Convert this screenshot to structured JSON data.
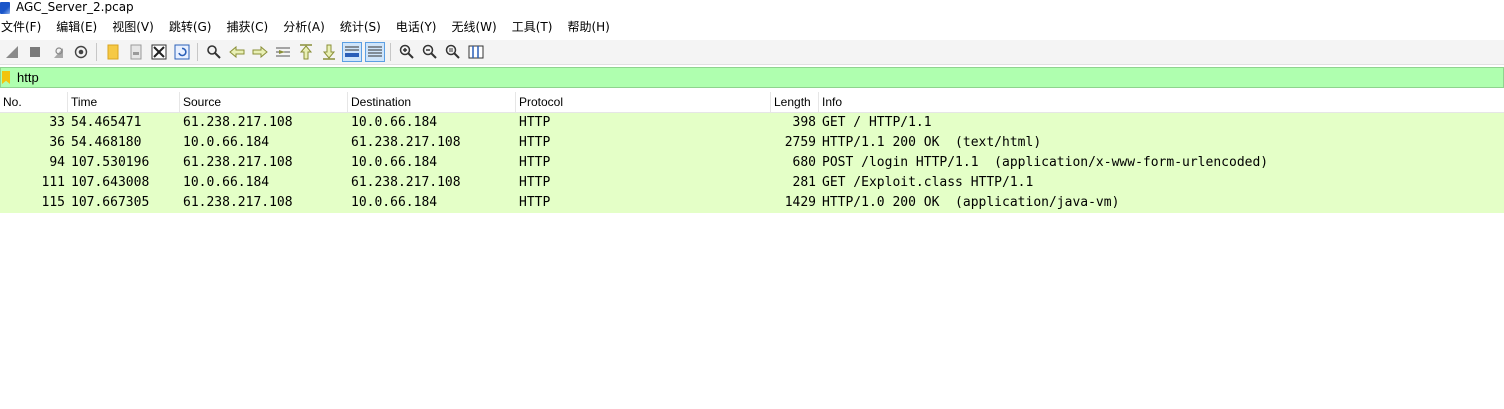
{
  "window": {
    "title": "AGC_Server_2.pcap"
  },
  "menu": [
    "文件(F)",
    "编辑(E)",
    "视图(V)",
    "跳转(G)",
    "捕获(C)",
    "分析(A)",
    "统计(S)",
    "电话(Y)",
    "无线(W)",
    "工具(T)",
    "帮助(H)"
  ],
  "toolbar": {
    "icons": [
      "start-capture-icon",
      "stop-capture-icon",
      "restart-capture-icon",
      "capture-options-icon",
      "open-file-icon",
      "save-file-icon",
      "close-file-icon",
      "reload-file-icon",
      "find-packet-icon",
      "go-back-icon",
      "go-forward-icon",
      "go-to-packet-icon",
      "first-packet-icon",
      "last-packet-icon",
      "autoscroll-icon",
      "colorize-icon",
      "zoom-in-icon",
      "zoom-out-icon",
      "normal-size-icon",
      "resize-columns-icon"
    ]
  },
  "filter": {
    "value": "http"
  },
  "columns": [
    "No.",
    "Time",
    "Source",
    "Destination",
    "Protocol",
    "Length",
    "Info"
  ],
  "packets": [
    {
      "no": "33",
      "time": "54.465471",
      "source": "61.238.217.108",
      "destination": "10.0.66.184",
      "protocol": "HTTP",
      "length": "398",
      "info": "GET / HTTP/1.1"
    },
    {
      "no": "36",
      "time": "54.468180",
      "source": "10.0.66.184",
      "destination": "61.238.217.108",
      "protocol": "HTTP",
      "length": "2759",
      "info": "HTTP/1.1 200 OK  (text/html)"
    },
    {
      "no": "94",
      "time": "107.530196",
      "source": "61.238.217.108",
      "destination": "10.0.66.184",
      "protocol": "HTTP",
      "length": "680",
      "info": "POST /login HTTP/1.1  (application/x-www-form-urlencoded)"
    },
    {
      "no": "111",
      "time": "107.643008",
      "source": "10.0.66.184",
      "destination": "61.238.217.108",
      "protocol": "HTTP",
      "length": "281",
      "info": "GET /Exploit.class HTTP/1.1"
    },
    {
      "no": "115",
      "time": "107.667305",
      "source": "61.238.217.108",
      "destination": "10.0.66.184",
      "protocol": "HTTP",
      "length": "1429",
      "info": "HTTP/1.0 200 OK  (application/java-vm)"
    }
  ],
  "colors": {
    "row_bg": "#e4ffc7",
    "filter_bg": "#afffaf",
    "accent": "#1a55c9"
  }
}
